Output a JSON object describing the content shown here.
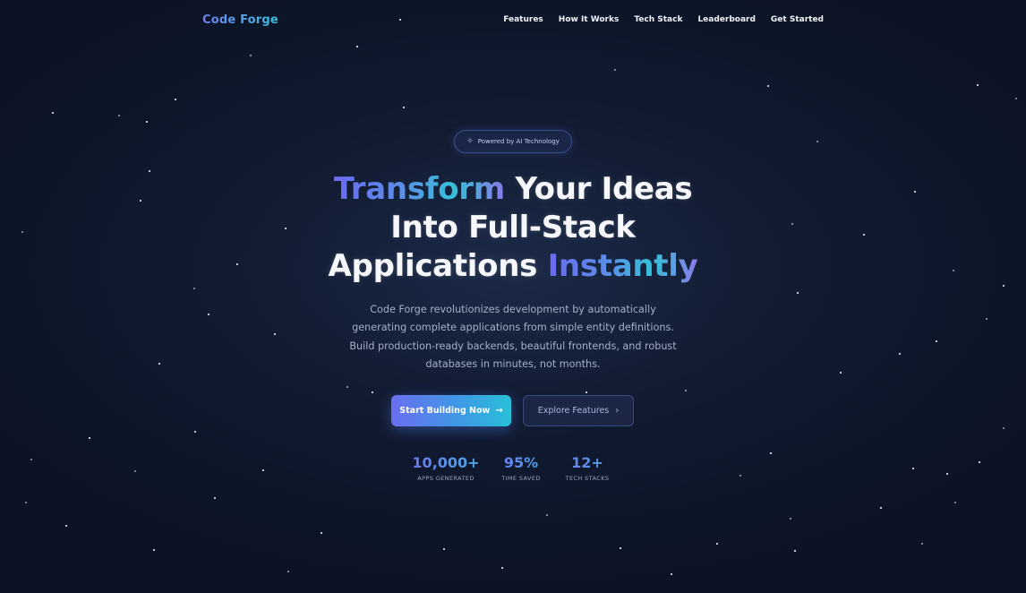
{
  "brand": "Code Forge",
  "nav": {
    "items": [
      "Features",
      "How It Works",
      "Tech Stack",
      "Leaderboard",
      "Get Started"
    ]
  },
  "hero": {
    "badge": {
      "icon": "sparkle-icon",
      "text": "Powered by AI Technology"
    },
    "headline": {
      "part1": "Transform",
      "part2": " Your Ideas",
      "part3": "Into Full-Stack",
      "part4": "Applications ",
      "part5": "Instantly"
    },
    "subtitle": "Code Forge revolutionizes development by automatically generating complete applications from simple entity definitions. Build production-ready backends, beautiful frontends, and robust databases in minutes, not months.",
    "primary_button": {
      "label": "Start Building Now",
      "icon": "arrow-right-icon"
    },
    "secondary_button": {
      "label": "Explore Features",
      "icon": "chevron-right-icon"
    }
  },
  "stats": [
    {
      "value": "10,000+",
      "label": "APPS GENERATED"
    },
    {
      "value": "95%",
      "label": "TIME SAVED"
    },
    {
      "value": "12+",
      "label": "TECH STACKS"
    }
  ],
  "colors": {
    "background": "#111b31",
    "accent_start": "#6a6ef0",
    "accent_end": "#27c0d8"
  }
}
